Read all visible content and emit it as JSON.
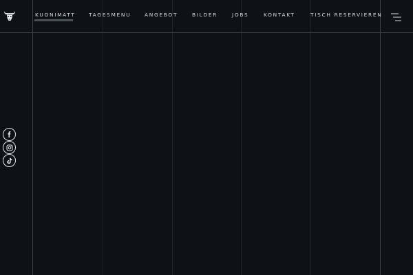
{
  "header": {
    "logo_icon": "bull-head-icon",
    "nav_items": [
      {
        "label": "KUONIMATT",
        "active": true
      },
      {
        "label": "TAGESMENU"
      },
      {
        "label": "ANGEBOT"
      },
      {
        "label": "BILDER"
      },
      {
        "label": "JOBS"
      },
      {
        "label": "KONTAKT"
      },
      {
        "label": "TISCH RESERVIEREN"
      }
    ],
    "menu_icon": "hamburger-menu-icon"
  },
  "social": [
    {
      "icon": "facebook-icon"
    },
    {
      "icon": "instagram-icon"
    },
    {
      "icon": "tiktok-icon"
    }
  ],
  "colors": {
    "background": "#0c1215",
    "text": "#d8dcdd",
    "grid_line": "#1f2629",
    "border_line": "#3a4144",
    "active_underline": "#4c5356"
  }
}
